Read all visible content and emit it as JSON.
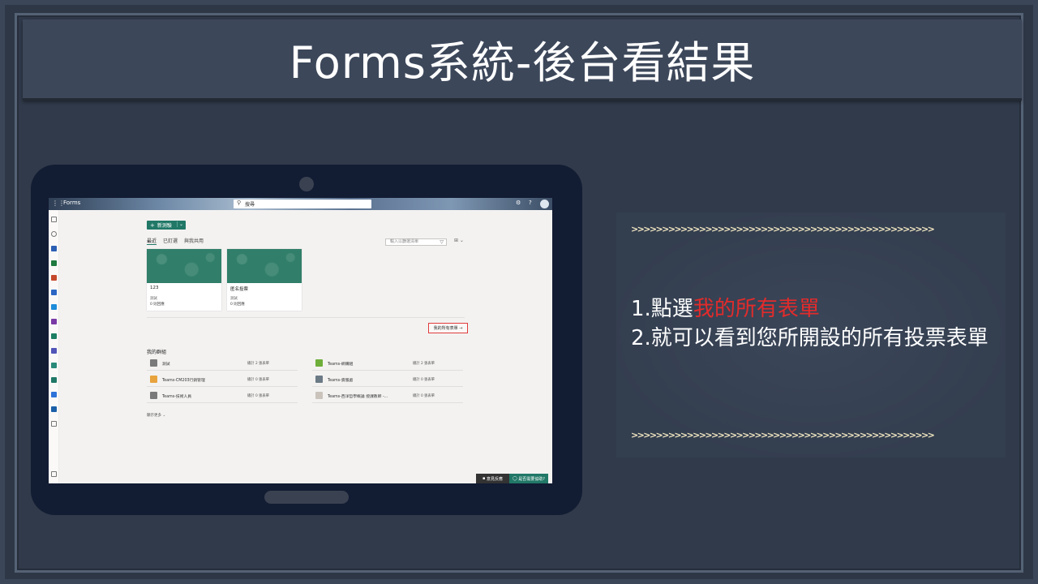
{
  "slide": {
    "title": "Forms系統-後台看結果"
  },
  "app": {
    "name": "Forms",
    "search_placeholder": "搜尋",
    "new_button": "新測驗",
    "tabs": [
      {
        "label": "最近",
        "active": true
      },
      {
        "label": "已釘選",
        "active": false
      },
      {
        "label": "與我共用",
        "active": false
      }
    ],
    "filter_placeholder": "輸入以篩選清單",
    "cards": [
      {
        "title": "123",
        "subtitle": "測試",
        "responses": "0 則回應"
      },
      {
        "title": "匿名投票",
        "subtitle": "測試",
        "responses": "0 則回應"
      }
    ],
    "all_forms_link": "我的所有表單",
    "groups_title": "我的群組",
    "groups": [
      {
        "name": "測試",
        "count": "總計 2 張表單",
        "color": "#7a7a7a"
      },
      {
        "name": "Teams-網購組",
        "count": "總計 2 張表單",
        "color": "#6fae3a"
      },
      {
        "name": "Teams-CM203行銷管理",
        "count": "總計 0 張表單",
        "color": "#e8a33d"
      },
      {
        "name": "Teams-資服處",
        "count": "總計 0 張表單",
        "color": "#6b7a85"
      },
      {
        "name": "Teams-技術人員",
        "count": "總計 0 張表單",
        "color": "#7a7a7a"
      },
      {
        "name": "Teams-西洋哲學概論 授課教師 -...",
        "count": "總計 0 張表單",
        "color": "#c9c3bb"
      }
    ],
    "show_more": "顯示更多",
    "feedback": "意見反應",
    "help": "是否需要協助?"
  },
  "instructions": {
    "arrows": ">>>>>>>>>>>>>>>>>>>>>>>>>>>>>>>>>>>>>>>>>>>>>>>>>",
    "step1_prefix": "1.點選",
    "step1_highlight": "我的所有表單",
    "step2": "2.就可以看到您所開設的所有投票表單",
    "highlight_color": "#e32b2b"
  }
}
